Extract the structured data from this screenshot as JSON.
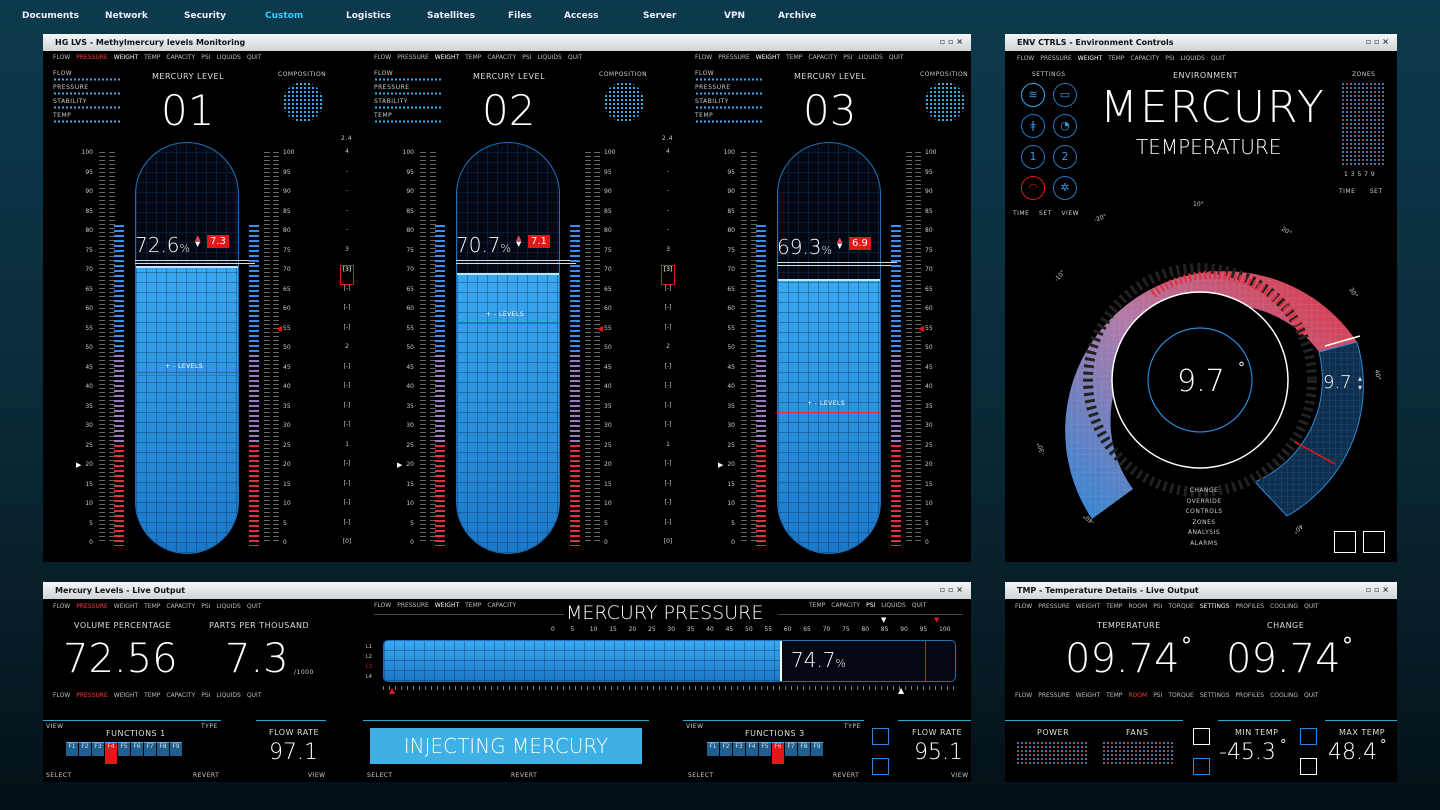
{
  "nav": [
    "Documents",
    "Network",
    "Security",
    "Custom",
    "Logistics",
    "Satellites",
    "Files",
    "Access",
    "Server",
    "VPN",
    "Archive"
  ],
  "nav_active": "Custom",
  "colors": {
    "accent": "#2fa8ea",
    "red": "#e01818",
    "nav_active": "#2ad1ff"
  },
  "w1": {
    "title": "HG LVS - Methylmercury levels Monitoring",
    "menu": [
      "FLOW",
      "PRESSURE",
      "WEIGHT",
      "TEMP",
      "CAPACITY",
      "PSI",
      "LIQUIDS",
      "QUIT"
    ],
    "side_labels": [
      "FLOW",
      "PRESSURE",
      "STABILITY",
      "TEMP"
    ],
    "heading": "MERCURY LEVEL",
    "composition": "COMPOSITION",
    "levels_label": "+ - LEVELS",
    "top_marker": "2.4",
    "scale": [
      "100",
      "95",
      "90",
      "85",
      "80",
      "75",
      "70",
      "65",
      "60",
      "55",
      "50",
      "45",
      "40",
      "35",
      "30",
      "25",
      "20",
      "15",
      "10",
      "5",
      "0"
    ],
    "right_scale": [
      "4",
      "-",
      "-",
      "-",
      "-",
      "3",
      "[3]",
      "[-]",
      "[-]",
      "[-]",
      "2",
      "[-]",
      "[-]",
      "[-]",
      "[-]",
      "1",
      "[-]",
      "[-]",
      "[-]",
      "[-]",
      "[0]"
    ],
    "tanks": [
      {
        "id": "01",
        "pct": "72.6",
        "unit": "%",
        "delta": "7.3",
        "fill": 0.726
      },
      {
        "id": "02",
        "pct": "70.7",
        "unit": "%",
        "delta": "7.1",
        "fill": 0.707
      },
      {
        "id": "03",
        "pct": "69.3",
        "unit": "%",
        "delta": "6.9",
        "fill": 0.693
      }
    ]
  },
  "w2": {
    "title": "ENV CTRLS - Environment Controls",
    "menu": [
      "FLOW",
      "PRESSURE",
      "WEIGHT",
      "TEMP",
      "CAPACITY",
      "PSI",
      "LIQUIDS",
      "QUIT"
    ],
    "settings": "SETTINGS",
    "environment": "ENVIRONMENT",
    "zones": "ZONES",
    "big1": "MERCURY",
    "big2": "TEMPERATURE",
    "footer_left": [
      "TIME",
      "SET",
      "VIEW"
    ],
    "zone_numbers": "1  3  5  7  9",
    "footer_right": [
      "TIME",
      "SET"
    ],
    "dial_value": "9.7",
    "side_value": "9.7",
    "deg": "°",
    "dial_ticks": [
      "-20°",
      "-10°",
      "10°",
      "20°",
      "30°",
      "40°",
      "40°",
      "-40°",
      "-30°"
    ],
    "menu_list": [
      "CHANGE",
      "OVERRIDE",
      "CONTROLS",
      "ZONES",
      "ANALYSIS",
      "ALARMS"
    ]
  },
  "w3": {
    "title": "Mercury Levels - Live Output",
    "menu_left": [
      "FLOW",
      "PRESSURE",
      "WEIGHT",
      "TEMP",
      "CAPACITY",
      "PSI",
      "LIQUIDS",
      "QUIT"
    ],
    "menu_mid_left": [
      "FLOW",
      "PRESSURE",
      "WEIGHT",
      "TEMP",
      "CAPACITY"
    ],
    "menu_mid_right": [
      "TEMP",
      "CAPACITY",
      "PSI",
      "LIQUIDS",
      "QUIT"
    ],
    "vol_label": "VOLUME  PERCENTAGE",
    "vol_value": "72.56",
    "ppt_label": "PARTS PER THOUSAND",
    "ppt_value": "7.3",
    "ppt_unit": "/1000",
    "pressure_title": "MERCURY PRESSURE",
    "pressure_scale": [
      "0",
      "5",
      "10",
      "15",
      "20",
      "25",
      "30",
      "35",
      "40",
      "45",
      "50",
      "55",
      "60",
      "65",
      "70",
      "75",
      "80",
      "85",
      "90",
      "95",
      "100"
    ],
    "pressure_pct": "74.7",
    "pressure_fill": 0.747,
    "rows": [
      "L1",
      "L2",
      "L3",
      "L4"
    ],
    "func1": "FUNCTIONS 1",
    "func3": "FUNCTIONS 3",
    "view": "VIEW",
    "type": "TYPE",
    "select": "SELECT",
    "revert": "REVERT",
    "fkeys": [
      "F1",
      "F2",
      "F3",
      "F4",
      "F5",
      "F6",
      "F7",
      "F8",
      "F9"
    ],
    "flow_label": "FLOW RATE",
    "flow1": "97.1",
    "flow2": "95.1",
    "inject": "INJECTING MERCURY"
  },
  "w4": {
    "title": "TMP - Temperature Details - Live Output",
    "menu": [
      "FLOW",
      "PRESSURE",
      "WEIGHT",
      "TEMP",
      "ROOM",
      "PSI",
      "TORQUE",
      "SETTINGS",
      "PROFILES",
      "COOLING",
      "QUIT"
    ],
    "temp_label": "TEMPERATURE",
    "temp_value": "09.74",
    "change_label": "CHANGE",
    "change_value": "09.74",
    "deg": "°",
    "power": "POWER",
    "fans": "FANS",
    "min_label": "MIN TEMP",
    "min_value": "-45.3",
    "max_label": "MAX TEMP",
    "max_value": "48.4"
  }
}
